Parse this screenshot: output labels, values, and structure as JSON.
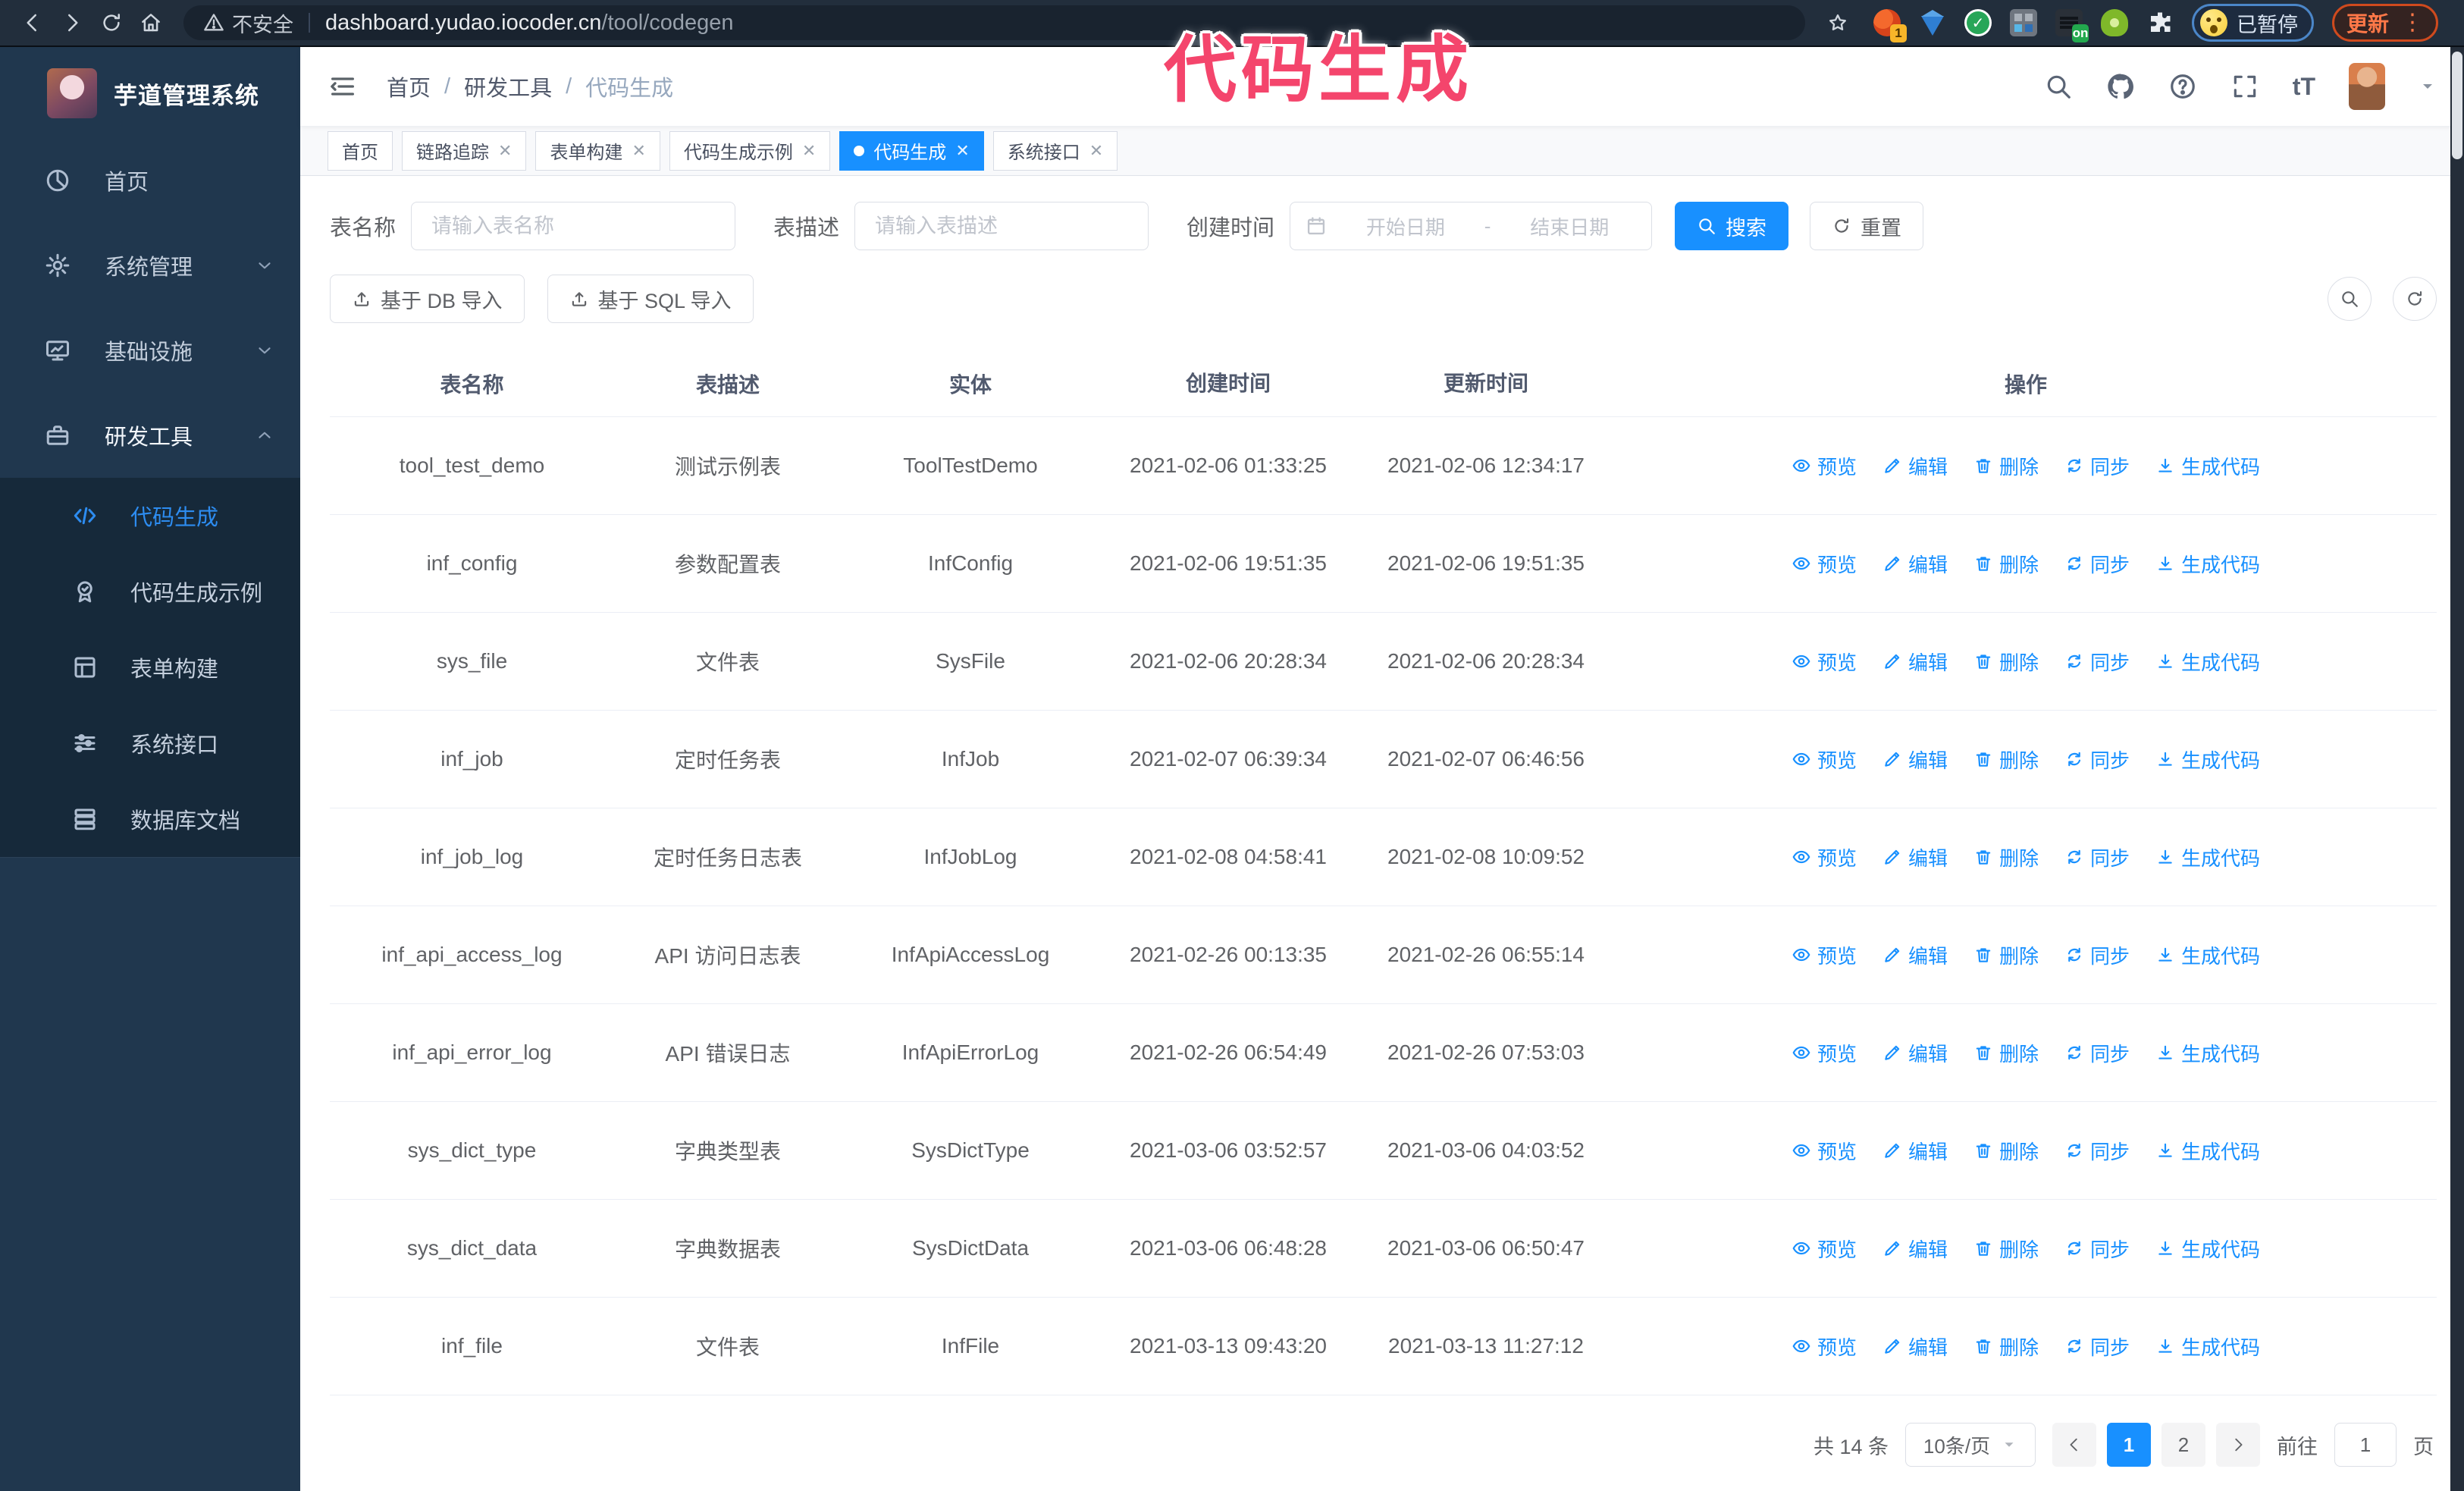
{
  "browser": {
    "security_label": "不安全",
    "url_host": "dashboard.yudao.iocoder.cn",
    "url_path": "/tool/codegen",
    "ext_badge_count": "1",
    "ext_badge_on": "on",
    "paused_badge": "已暂停",
    "update_button": "更新"
  },
  "annotation": {
    "text": "代码生成",
    "color": "#f4456c"
  },
  "sidebar": {
    "title": "芋道管理系统",
    "items": [
      {
        "label": "首页",
        "icon": "dashboard-icon",
        "chevron": "none",
        "active": false
      },
      {
        "label": "系统管理",
        "icon": "gear-icon",
        "chevron": "down",
        "active": false
      },
      {
        "label": "基础设施",
        "icon": "monitor-icon",
        "chevron": "down",
        "active": false
      },
      {
        "label": "研发工具",
        "icon": "toolbox-icon",
        "chevron": "up",
        "active": true
      }
    ],
    "sub_items": [
      {
        "label": "代码生成",
        "icon": "code-icon",
        "active": true
      },
      {
        "label": "代码生成示例",
        "icon": "badge-icon",
        "active": false
      },
      {
        "label": "表单构建",
        "icon": "form-icon",
        "active": false
      },
      {
        "label": "系统接口",
        "icon": "sliders-icon",
        "active": false
      },
      {
        "label": "数据库文档",
        "icon": "database-icon",
        "active": false
      }
    ]
  },
  "header": {
    "breadcrumb": [
      "首页",
      "研发工具",
      "代码生成"
    ]
  },
  "tags": [
    {
      "label": "首页",
      "closable": false,
      "active": false
    },
    {
      "label": "链路追踪",
      "closable": true,
      "active": false
    },
    {
      "label": "表单构建",
      "closable": true,
      "active": false
    },
    {
      "label": "代码生成示例",
      "closable": true,
      "active": false
    },
    {
      "label": "代码生成",
      "closable": true,
      "active": true
    },
    {
      "label": "系统接口",
      "closable": true,
      "active": false
    }
  ],
  "search": {
    "name_label": "表名称",
    "name_placeholder": "请输入表名称",
    "desc_label": "表描述",
    "desc_placeholder": "请输入表描述",
    "time_label": "创建时间",
    "start_placeholder": "开始日期",
    "range_separator": "-",
    "end_placeholder": "结束日期",
    "search_button": "搜索",
    "reset_button": "重置"
  },
  "toolbar": {
    "import_db": "基于 DB 导入",
    "import_sql": "基于 SQL 导入"
  },
  "table": {
    "columns": [
      "表名称",
      "表描述",
      "实体",
      "创建时间",
      "更新时间",
      "操作"
    ],
    "row_actions": [
      "预览",
      "编辑",
      "删除",
      "同步",
      "生成代码"
    ],
    "rows": [
      {
        "name": "tool_test_demo",
        "desc": "测试示例表",
        "entity": "ToolTestDemo",
        "created": "2021-02-06 01:33:25",
        "updated": "2021-02-06 12:34:17"
      },
      {
        "name": "inf_config",
        "desc": "参数配置表",
        "entity": "InfConfig",
        "created": "2021-02-06 19:51:35",
        "updated": "2021-02-06 19:51:35"
      },
      {
        "name": "sys_file",
        "desc": "文件表",
        "entity": "SysFile",
        "created": "2021-02-06 20:28:34",
        "updated": "2021-02-06 20:28:34"
      },
      {
        "name": "inf_job",
        "desc": "定时任务表",
        "entity": "InfJob",
        "created": "2021-02-07 06:39:34",
        "updated": "2021-02-07 06:46:56"
      },
      {
        "name": "inf_job_log",
        "desc": "定时任务日志表",
        "entity": "InfJobLog",
        "created": "2021-02-08 04:58:41",
        "updated": "2021-02-08 10:09:52"
      },
      {
        "name": "inf_api_access_log",
        "desc": "API 访问日志表",
        "entity": "InfApiAccessLog",
        "created": "2021-02-26 00:13:35",
        "updated": "2021-02-26 06:55:14"
      },
      {
        "name": "inf_api_error_log",
        "desc": "API 错误日志",
        "entity": "InfApiErrorLog",
        "created": "2021-02-26 06:54:49",
        "updated": "2021-02-26 07:53:03"
      },
      {
        "name": "sys_dict_type",
        "desc": "字典类型表",
        "entity": "SysDictType",
        "created": "2021-03-06 03:52:57",
        "updated": "2021-03-06 04:03:52"
      },
      {
        "name": "sys_dict_data",
        "desc": "字典数据表",
        "entity": "SysDictData",
        "created": "2021-03-06 06:48:28",
        "updated": "2021-03-06 06:50:47"
      },
      {
        "name": "inf_file",
        "desc": "文件表",
        "entity": "InfFile",
        "created": "2021-03-13 09:43:20",
        "updated": "2021-03-13 11:27:12"
      }
    ]
  },
  "pagination": {
    "total_text": "共 14 条",
    "page_size": "10条/页",
    "pages": [
      "1",
      "2"
    ],
    "active_page": "1",
    "goto_label": "前往",
    "goto_value": "1",
    "page_unit": "页"
  },
  "colors": {
    "accent": "#1890ff",
    "sidebar_bg": "#20374e",
    "submenu_bg": "#16293a",
    "chrome_bg": "#222e3c"
  }
}
